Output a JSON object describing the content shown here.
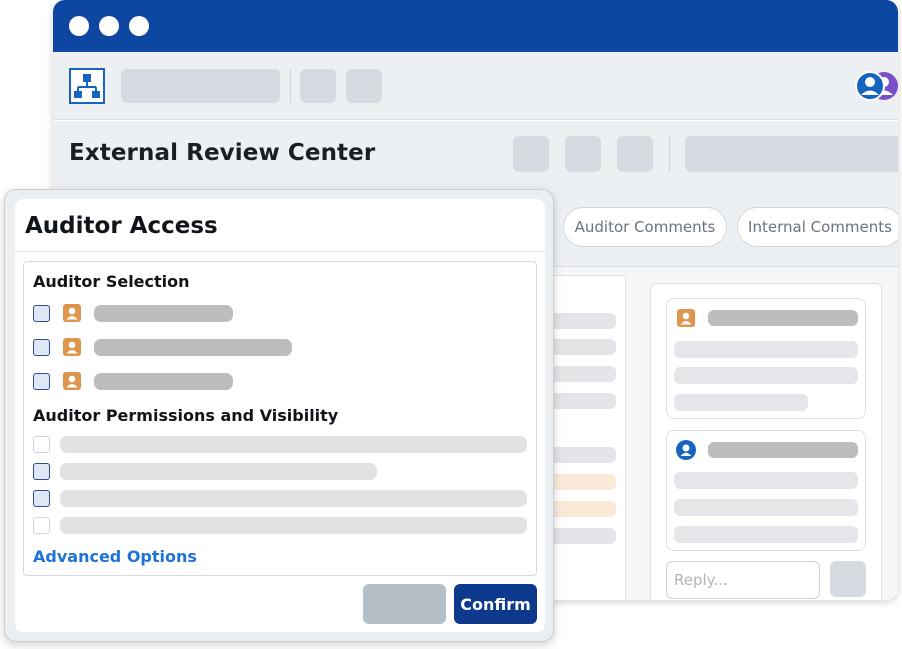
{
  "window": {
    "title": "External Review Center",
    "controls": [
      "window-dot-1",
      "window-dot-2",
      "window-dot-3"
    ]
  },
  "toolbar": {
    "logo_icon": "hierarchy-icon",
    "users_icon": "users-icon"
  },
  "tabs": [
    {
      "label": "Auditor Comments"
    },
    {
      "label": "Internal Comments"
    }
  ],
  "comments": {
    "reply_placeholder": "Reply..."
  },
  "modal": {
    "title": "Auditor Access",
    "selection_heading": "Auditor Selection",
    "auditors": [
      {
        "checked": false,
        "icon": "person-icon"
      },
      {
        "checked": false,
        "icon": "person-icon"
      },
      {
        "checked": false,
        "icon": "person-icon"
      }
    ],
    "permissions_heading": "Auditor Permissions and Visibility",
    "permissions": [
      {
        "state": "disabled"
      },
      {
        "state": "enabled"
      },
      {
        "state": "enabled"
      },
      {
        "state": "disabled"
      }
    ],
    "advanced_link": "Advanced Options",
    "confirm_label": "Confirm"
  },
  "colors": {
    "titlebar": "#0d47a1",
    "accent": "#1565c0",
    "confirm": "#0d3a8c",
    "link": "#1e73d6",
    "avatar_orange": "#e0954f"
  }
}
